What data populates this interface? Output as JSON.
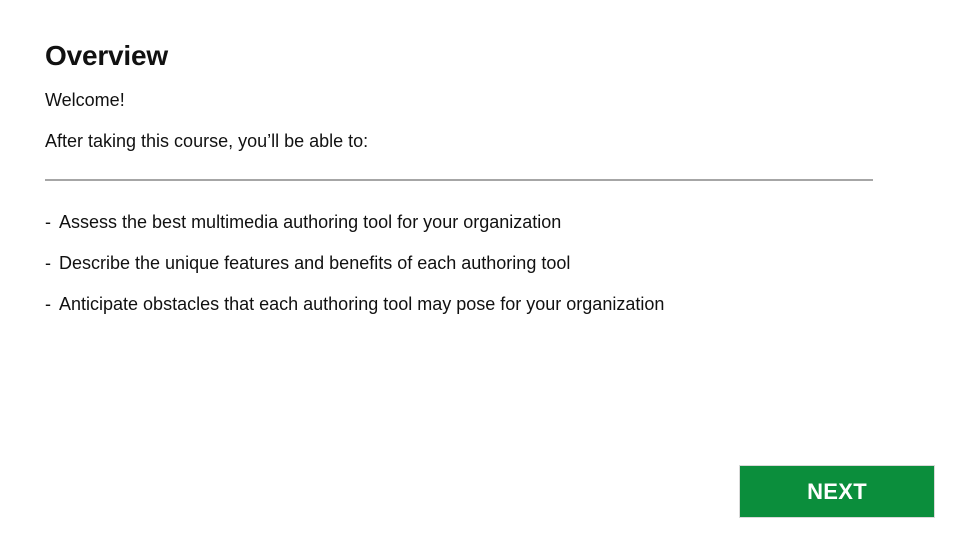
{
  "page": {
    "title": "Overview",
    "welcome": "Welcome!",
    "intro": "After taking this course, you’ll be able to:"
  },
  "objectives": [
    {
      "bullet": "-",
      "text": "Assess the best multimedia authoring tool for your organization"
    },
    {
      "bullet": "-",
      "text": "Describe the unique features and benefits of each authoring tool"
    },
    {
      "bullet": "-",
      "text": "Anticipate obstacles that each authoring tool may pose for your organization"
    }
  ],
  "navigation": {
    "next_label": "NEXT"
  },
  "colors": {
    "next_button_background": "#0b8e3c",
    "divider": "#a6a6a6",
    "text": "#111111",
    "background": "#ffffff"
  }
}
